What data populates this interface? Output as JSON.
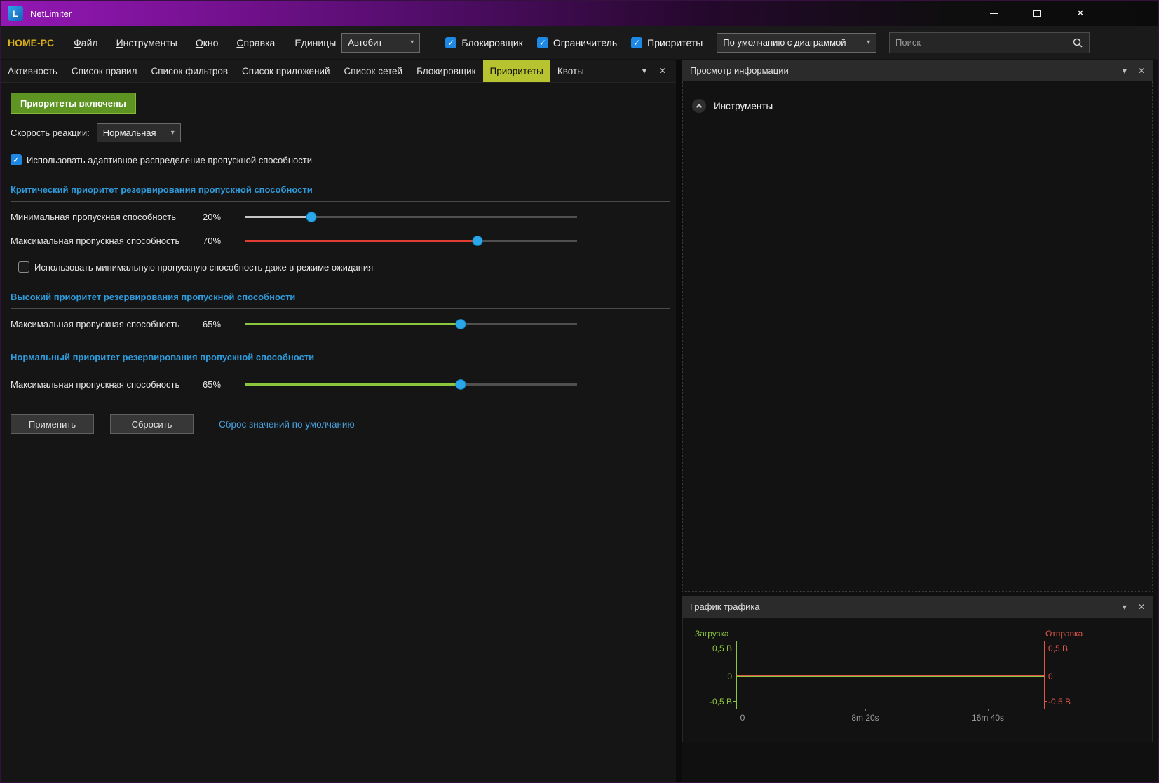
{
  "window": {
    "title": "NetLimiter"
  },
  "icons": {
    "check": "✓",
    "close": "✕",
    "chevron_down": "▾"
  },
  "menubar": {
    "computer_name": "HOME-PC",
    "menus": [
      "Файл",
      "Инструменты",
      "Окно",
      "Справка"
    ],
    "units_label": "Единицы",
    "units_value": "Автобит",
    "toggles": [
      {
        "id": "blocker",
        "label": "Блокировщик",
        "checked": true
      },
      {
        "id": "limiter",
        "label": "Ограничитель",
        "checked": true
      },
      {
        "id": "priorities",
        "label": "Приоритеты",
        "checked": true
      }
    ],
    "layout_value": "По умолчанию с диаграммой",
    "search_placeholder": "Поиск"
  },
  "tabs": {
    "items": [
      {
        "id": "activity",
        "label": "Активность",
        "active": false
      },
      {
        "id": "rule-list",
        "label": "Список правил",
        "active": false
      },
      {
        "id": "filter-list",
        "label": "Список фильтров",
        "active": false
      },
      {
        "id": "app-list",
        "label": "Список приложений",
        "active": false
      },
      {
        "id": "network-list",
        "label": "Список сетей",
        "active": false
      },
      {
        "id": "blocker",
        "label": "Блокировщик",
        "active": false
      },
      {
        "id": "priorities",
        "label": "Приоритеты",
        "active": true
      },
      {
        "id": "quotas",
        "label": "Квоты",
        "active": false
      }
    ]
  },
  "priorities": {
    "status_button": "Приоритеты включены",
    "reaction_speed": {
      "label": "Скорость реакции:",
      "value": "Нормальная"
    },
    "adaptive_checkbox": {
      "label": "Использовать адаптивное распределение пропускной способности",
      "checked": true
    },
    "critical_section": {
      "title": "Критический приоритет резервирования пропускной способности",
      "min_slider": {
        "label": "Минимальная пропускная способность",
        "value": "20%",
        "percent": 20,
        "fill_color": "#c4c4c4"
      },
      "max_slider": {
        "label": "Максимальная пропускная способность",
        "value": "70%",
        "percent": 70,
        "fill_color": "#e23d32"
      },
      "idle_checkbox": {
        "label": "Использовать минимальную пропускную способность даже в режиме ожидания",
        "checked": false
      }
    },
    "high_section": {
      "title": "Высокий приоритет резервирования пропускной способности",
      "max_slider": {
        "label": "Максимальная пропускная способность",
        "value": "65%",
        "percent": 65,
        "fill_color": "#8cc63e"
      }
    },
    "normal_section": {
      "title": "Нормальный приоритет резервирования пропускной способности",
      "max_slider": {
        "label": "Максимальная пропускная способность",
        "value": "65%",
        "percent": 65,
        "fill_color": "#8cc63e"
      }
    },
    "apply_button": "Применить",
    "reset_button": "Сбросить",
    "reset_defaults_link": "Сброс значений по умолчанию"
  },
  "info_panel": {
    "title": "Просмотр информации",
    "tools_label": "Инструменты"
  },
  "traffic_panel": {
    "title": "График трафика",
    "download_label": "Загрузка",
    "upload_label": "Отправка",
    "left_ticks": [
      "0,5 B",
      "0",
      "-0,5 B"
    ],
    "right_ticks": [
      "0,5 B",
      "0",
      "-0,5 B"
    ],
    "x_ticks": [
      "0",
      "8m 20s",
      "16m 40s"
    ],
    "download_color": "#8cc63e",
    "upload_color": "#e0564a"
  },
  "chart_data": {
    "type": "line",
    "title": "График трафика",
    "x_tick_labels": [
      "0",
      "8m 20s",
      "16m 40s"
    ],
    "y_tick_labels": [
      "0,5 B",
      "0",
      "-0,5 B"
    ],
    "ylim": [
      -0.5,
      0.5
    ],
    "grid": false,
    "legend_position": "top",
    "series": [
      {
        "name": "Загрузка",
        "color": "#8cc63e",
        "values": [
          0,
          0,
          0
        ]
      },
      {
        "name": "Отправка",
        "color": "#e0564a",
        "values": [
          0,
          0,
          0
        ]
      }
    ]
  }
}
